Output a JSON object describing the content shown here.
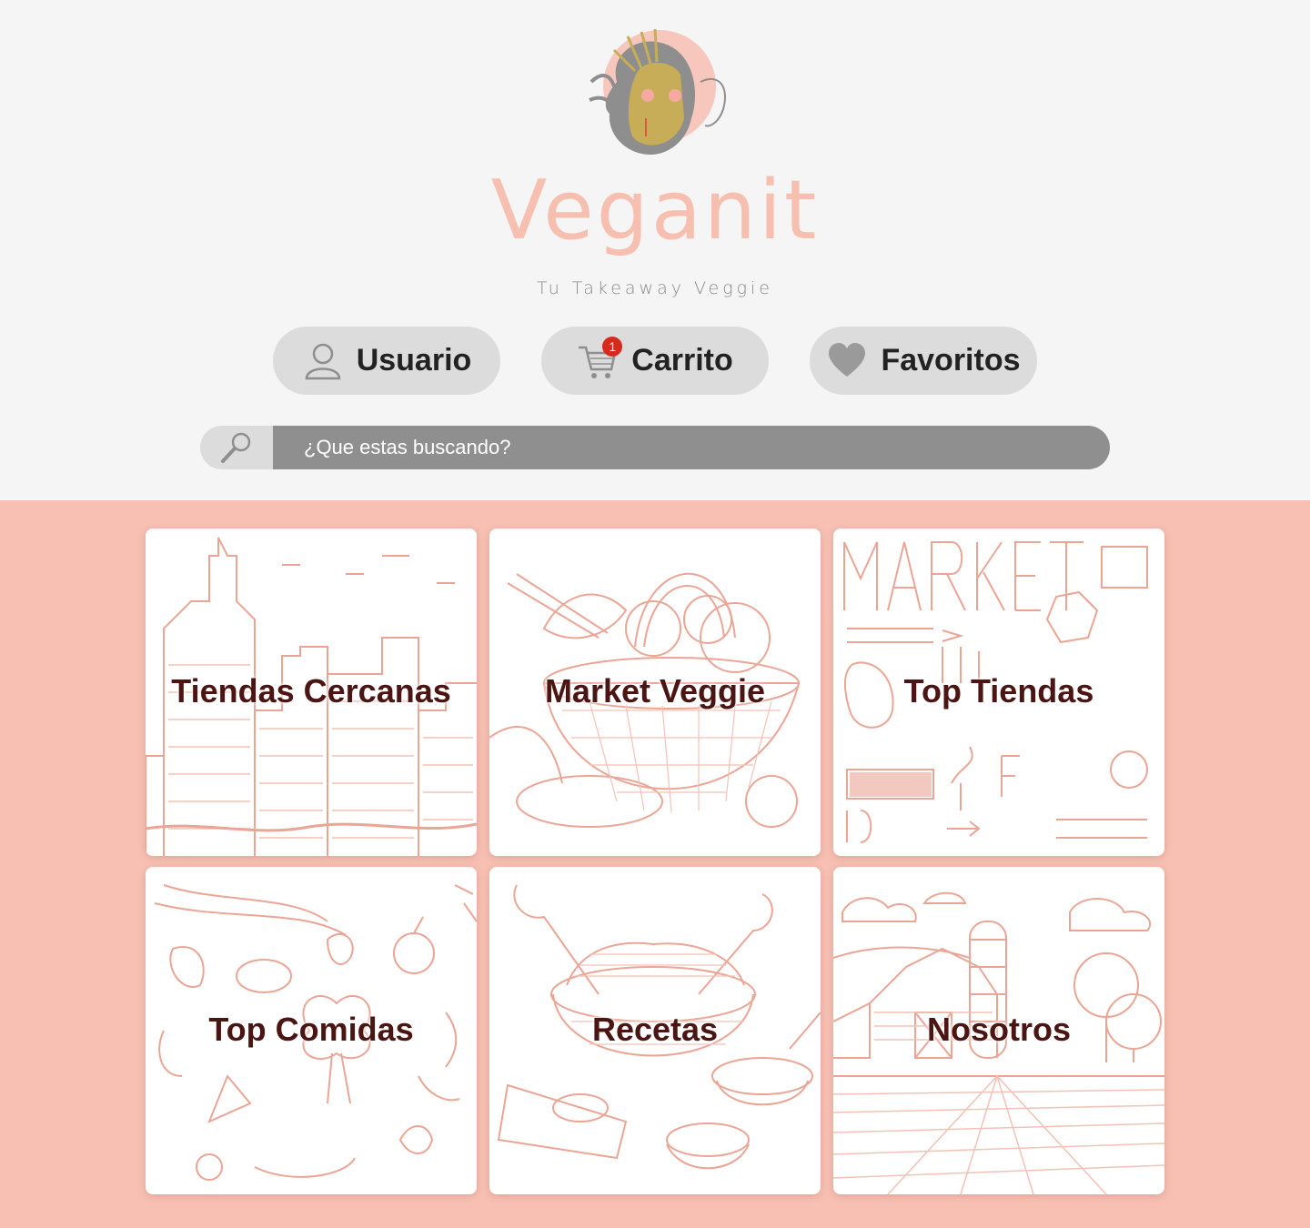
{
  "brand": {
    "name": "Veganit",
    "tagline": "Tu Takeaway Veggie",
    "brand_color": "#f7bfb0"
  },
  "nav": {
    "user_label": "Usuario",
    "cart_label": "Carrito",
    "cart_count": "1",
    "favorites_label": "Favoritos"
  },
  "search": {
    "placeholder": "¿Que estas buscando?"
  },
  "cards": [
    {
      "label": "Tiendas Cercanas",
      "art": "city-sketch"
    },
    {
      "label": "Market Veggie",
      "art": "vegetable-basket-sketch"
    },
    {
      "label": "Top Tiendas",
      "art": "farmers-market-lettering"
    },
    {
      "label": "Top Comidas",
      "art": "food-doodles"
    },
    {
      "label": "Recetas",
      "art": "salad-bowl-sketch"
    },
    {
      "label": "Nosotros",
      "art": "farm-barn-sketch"
    }
  ],
  "colors": {
    "page_bg": "#f5f5f5",
    "content_bg": "#f7c0b3",
    "card_text": "#4a1512",
    "sketch": "#eba595"
  }
}
